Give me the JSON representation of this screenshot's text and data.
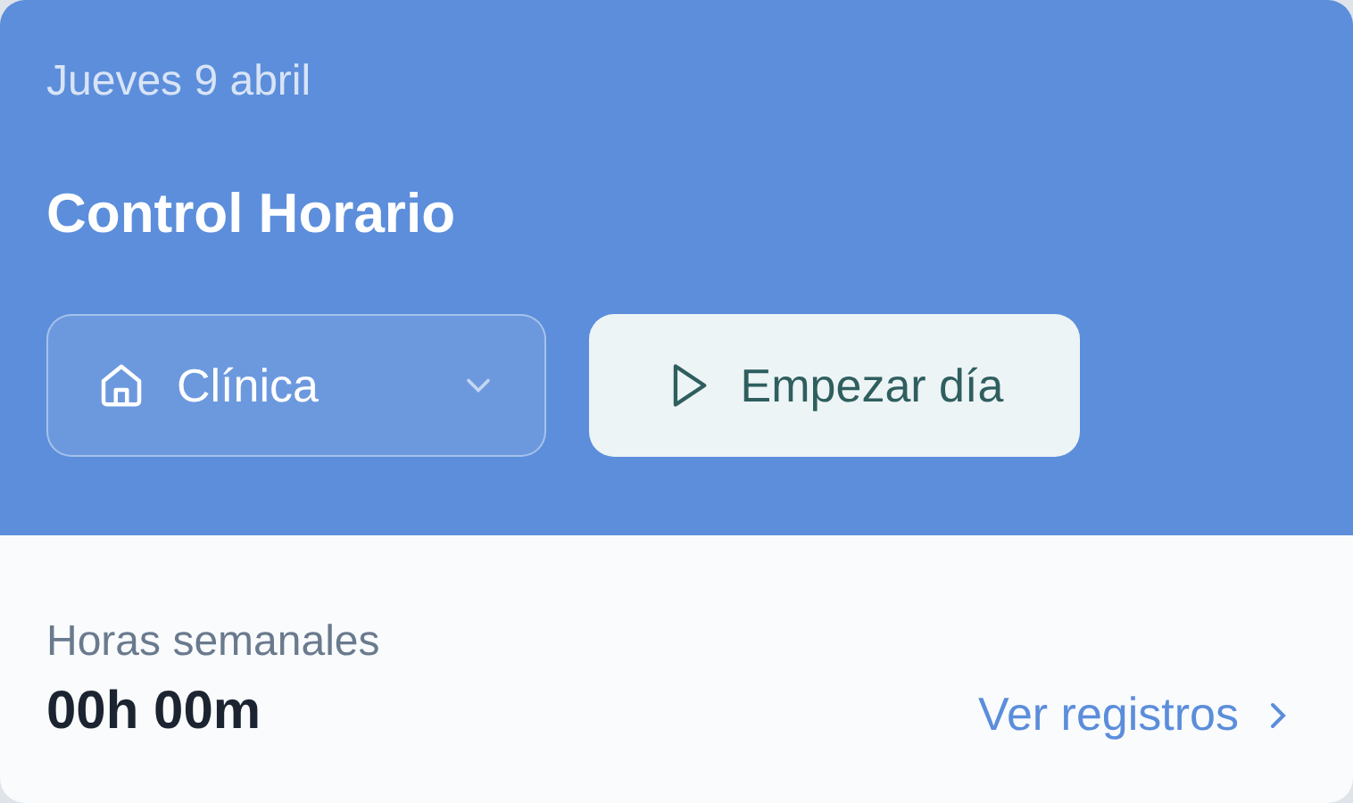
{
  "header": {
    "date": "Jueves 9 abril",
    "title": "Control Horario",
    "location_select": {
      "value": "Clínica"
    },
    "start_button": {
      "label": "Empezar día"
    }
  },
  "summary": {
    "label": "Horas semanales",
    "value": "00h 00m",
    "link": "Ver registros"
  }
}
